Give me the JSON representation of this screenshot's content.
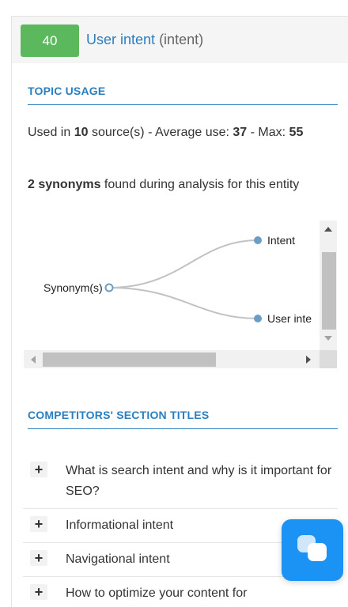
{
  "entity": {
    "score": "40",
    "name": "User intent",
    "id_text": "(intent)"
  },
  "topic_usage": {
    "heading": "TOPIC USAGE",
    "used_in_prefix": "Used in ",
    "source_count": "10",
    "used_in_suffix": " source(s) - Average use: ",
    "average_use": "37",
    "max_sep": " - Max: ",
    "max": "55",
    "synonyms_count_text": "2 synonyms",
    "synonyms_suffix": " found during analysis for this entity"
  },
  "synonym_graph": {
    "root_label": "Synonym(s)",
    "nodes": [
      "Intent",
      "User inte"
    ],
    "node_color": "#6a9ec5",
    "edge_color": "#c2c2c2"
  },
  "competitors_titles": {
    "heading": "COMPETITORS' SECTION TITLES",
    "items": [
      "What is search intent and why is it important for SEO?",
      "Informational intent",
      "Navigational intent",
      "How to optimize your content for"
    ],
    "expand_symbol": "+"
  },
  "colors": {
    "accent": "#2a7fc1",
    "score_badge": "#5cb85c",
    "chat_widget": "#1a93f5"
  },
  "icons": {
    "chat_widget": "chat-bubbles-icon",
    "expand": "plus-icon"
  }
}
